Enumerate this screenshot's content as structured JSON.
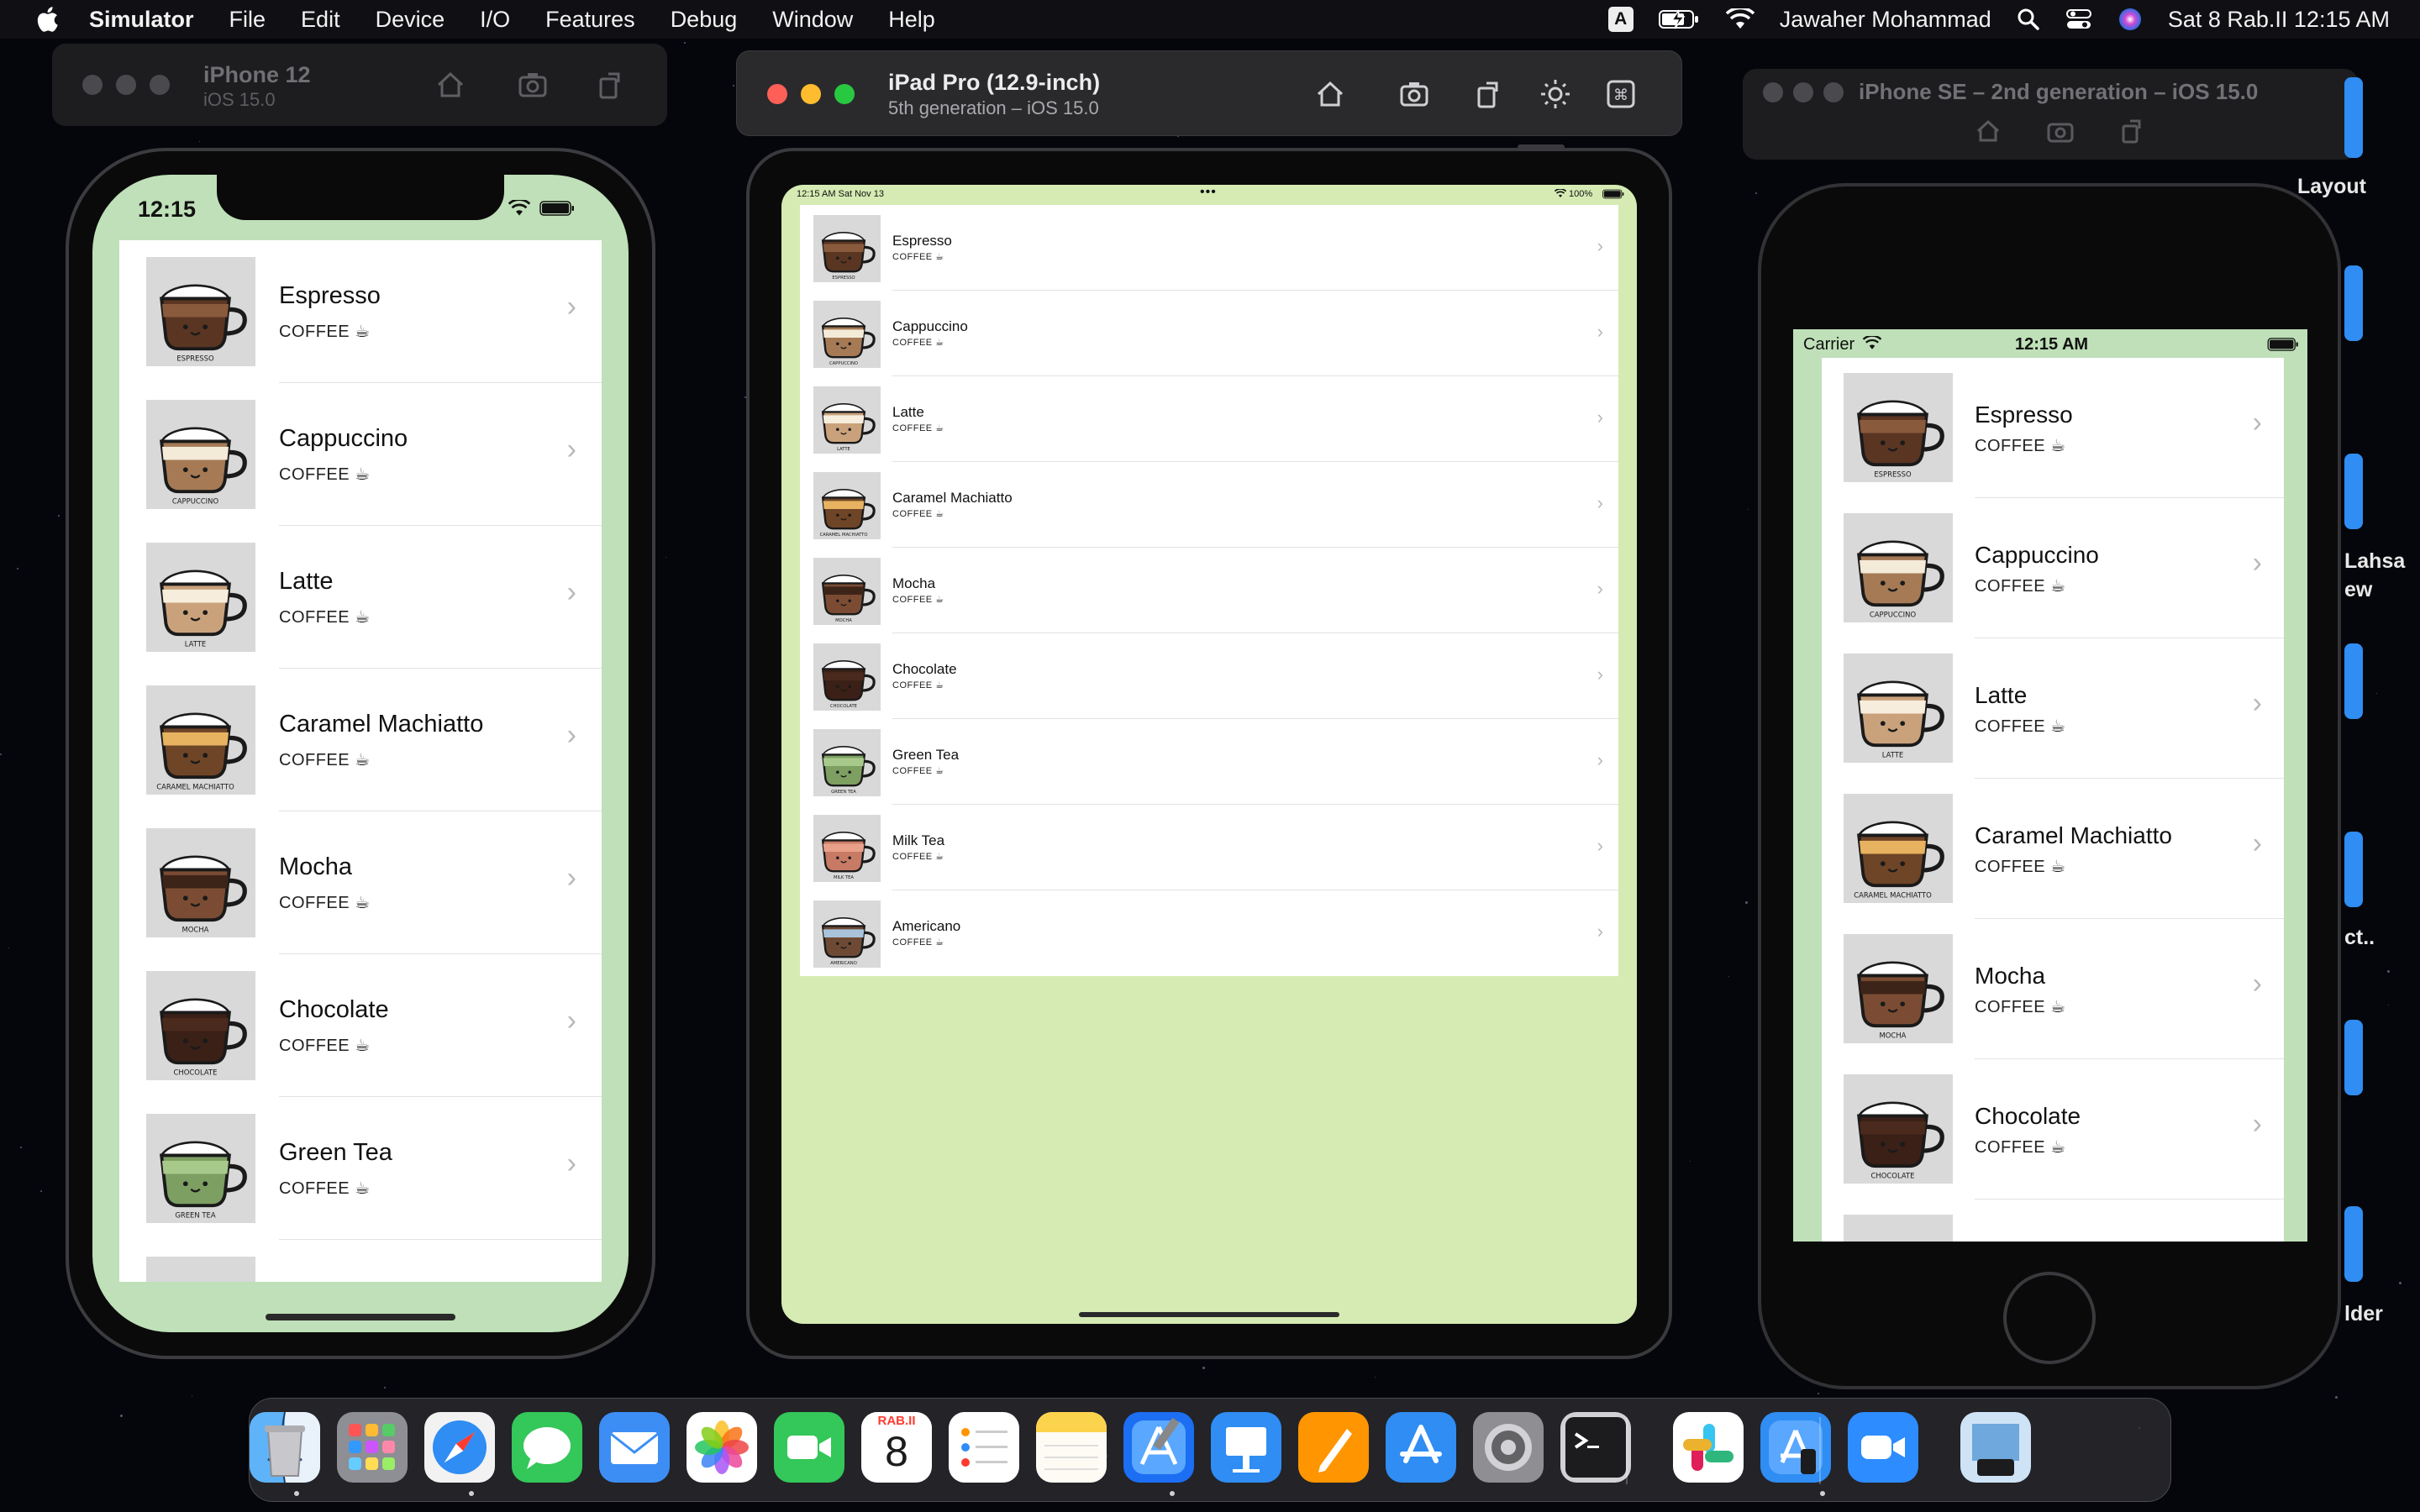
{
  "menubar": {
    "app_name": "Simulator",
    "menus": [
      "File",
      "Edit",
      "Device",
      "I/O",
      "Features",
      "Debug",
      "Window",
      "Help"
    ],
    "input_source": "A",
    "user": "Jawaher Mohammad",
    "datetime": "Sat 8 Rab.II  12:15 AM"
  },
  "simulators": {
    "iphone12": {
      "title": "iPhone 12",
      "subtitle": "iOS 15.0",
      "status_time": "12:15"
    },
    "ipad": {
      "title": "iPad Pro (12.9-inch)",
      "subtitle": "5th generation – iOS 15.0",
      "status_time": "12:15 AM   Sat Nov 13",
      "battery": "100%"
    },
    "iphonese": {
      "title": "iPhone SE – 2nd generation – iOS 15.0",
      "carrier": "Carrier",
      "status_time": "12:15 AM"
    }
  },
  "drinks": [
    {
      "name": "Espresso",
      "category": "COFFEE ☕",
      "caption": "ESPRESSO",
      "icon": "espresso-cup-icon",
      "colors": [
        "#8a5a3c",
        "#5a3522"
      ]
    },
    {
      "name": "Cappuccino",
      "category": "COFFEE ☕",
      "caption": "CAPPUCCINO",
      "icon": "cappuccino-cup-icon",
      "colors": [
        "#f4ead8",
        "#a57a55"
      ]
    },
    {
      "name": "Latte",
      "category": "COFFEE ☕",
      "caption": "LATTE",
      "icon": "latte-cup-icon",
      "colors": [
        "#f7eddc",
        "#c9a27c"
      ]
    },
    {
      "name": "Caramel Machiatto",
      "category": "COFFEE ☕",
      "caption": "CARAMEL MACHIATTO",
      "icon": "caramel-machiatto-cup-icon",
      "colors": [
        "#e7b361",
        "#6f4527"
      ]
    },
    {
      "name": "Mocha",
      "category": "COFFEE ☕",
      "caption": "MOCHA",
      "icon": "mocha-cup-icon",
      "colors": [
        "#3d2418",
        "#7b4c33"
      ]
    },
    {
      "name": "Chocolate",
      "category": "COFFEE ☕",
      "caption": "CHOCOLATE",
      "icon": "chocolate-cup-icon",
      "colors": [
        "#4a2a1c",
        "#3a2016"
      ]
    },
    {
      "name": "Green Tea",
      "category": "COFFEE ☕",
      "caption": "GREEN TEA",
      "icon": "green-tea-cup-icon",
      "colors": [
        "#a7c98a",
        "#7d9f62"
      ]
    },
    {
      "name": "Milk Tea",
      "category": "COFFEE ☕",
      "caption": "MILK TEA",
      "icon": "milk-tea-cup-icon",
      "colors": [
        "#e9a08a",
        "#c77b64"
      ]
    },
    {
      "name": "Americano",
      "category": "COFFEE ☕",
      "caption": "AMERICANO",
      "icon": "americano-cup-icon",
      "colors": [
        "#a9c3da",
        "#6e4a35"
      ]
    }
  ],
  "right_fragments": [
    "Layout",
    "Lahsa",
    "ew",
    "ct..",
    "lder"
  ],
  "dock": {
    "date_month": "RAB.II",
    "date_day": "8",
    "apps": [
      "finder-icon",
      "launchpad-icon",
      "safari-icon",
      "messages-icon",
      "mail-icon",
      "photos-icon",
      "facetime-icon",
      "calendar-icon",
      "reminders-icon",
      "notes-icon",
      "xcode-icon",
      "keynote-icon",
      "pages-icon",
      "app-store-icon",
      "system-preferences-icon",
      "terminal-icon",
      "slack-icon",
      "simulator-icon",
      "zoom-icon",
      "preview-icon",
      "trash-icon"
    ]
  },
  "colors": {
    "iphone_background": "#bfe0b8",
    "ipad_background": "#d5ebb3",
    "accent_blue": "#2f8df3"
  }
}
